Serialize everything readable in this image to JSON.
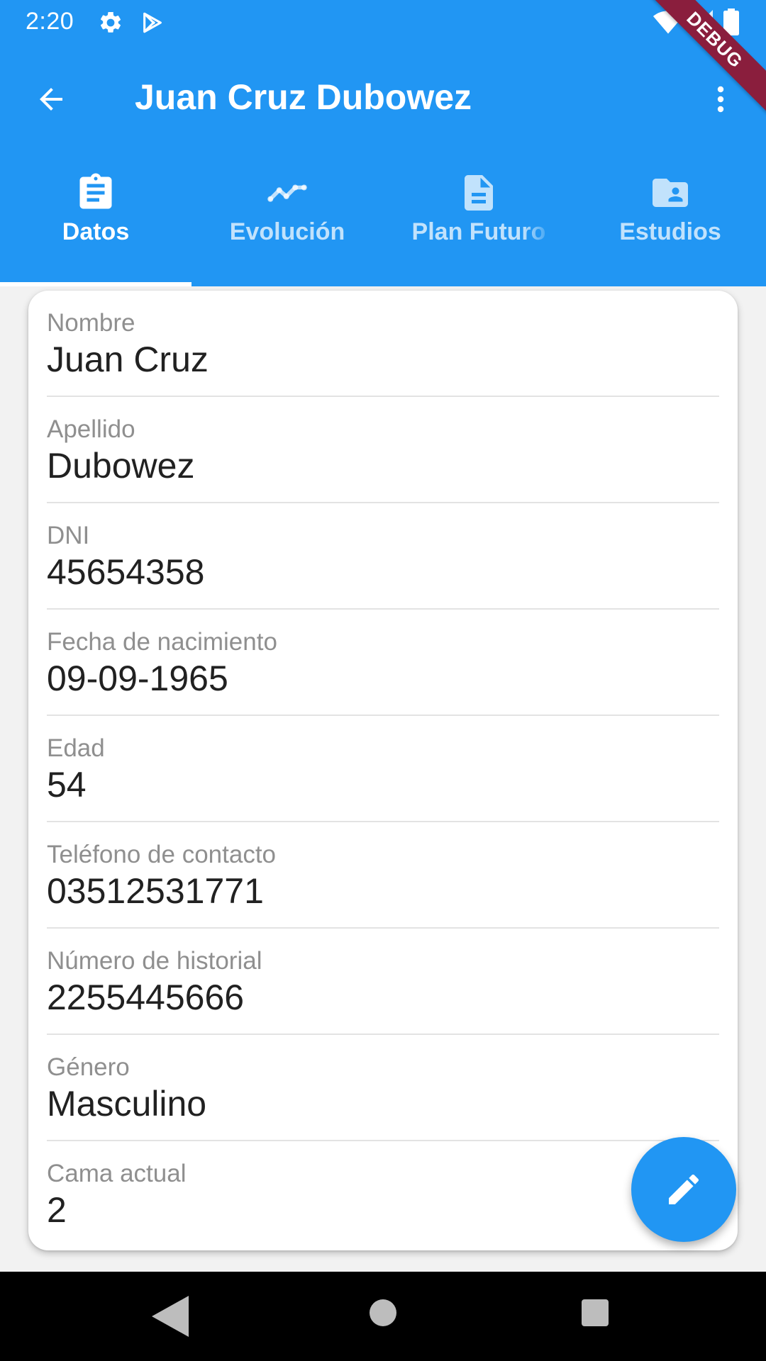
{
  "status_bar": {
    "time": "2:20",
    "icons": [
      "gear-icon",
      "play-store-icon",
      "wifi-icon",
      "signal-icon",
      "battery-icon"
    ]
  },
  "debug_banner": "DEBUG",
  "toolbar": {
    "title": "Juan Cruz Dubowez",
    "back_icon": "arrow-back-icon",
    "more_icon": "more-vert-icon"
  },
  "tabs": [
    {
      "label": "Datos",
      "icon": "assignment-icon",
      "active": true
    },
    {
      "label": "Evolución",
      "icon": "timeline-icon",
      "active": false
    },
    {
      "label": "Plan Futuro",
      "icon": "description-icon",
      "active": false
    },
    {
      "label": "Estudios",
      "icon": "folder-shared-icon",
      "active": false
    }
  ],
  "fields": [
    {
      "label": "Nombre",
      "value": "Juan Cruz"
    },
    {
      "label": "Apellido",
      "value": "Dubowez"
    },
    {
      "label": "DNI",
      "value": "45654358"
    },
    {
      "label": "Fecha de nacimiento",
      "value": "09-09-1965"
    },
    {
      "label": "Edad",
      "value": "54"
    },
    {
      "label": "Teléfono de contacto",
      "value": "03512531771"
    },
    {
      "label": "Número de historial",
      "value": "2255445666"
    },
    {
      "label": "Género",
      "value": "Masculino"
    },
    {
      "label": "Cama actual",
      "value": "2"
    }
  ],
  "fab": {
    "icon": "edit-icon"
  },
  "nav_bar": {
    "icons": [
      "nav-back-icon",
      "nav-home-icon",
      "nav-recents-icon"
    ]
  },
  "colors": {
    "primary": "#2196f3",
    "label_gray": "#8f8f8f",
    "debug_banner": "#8a1e3d"
  }
}
